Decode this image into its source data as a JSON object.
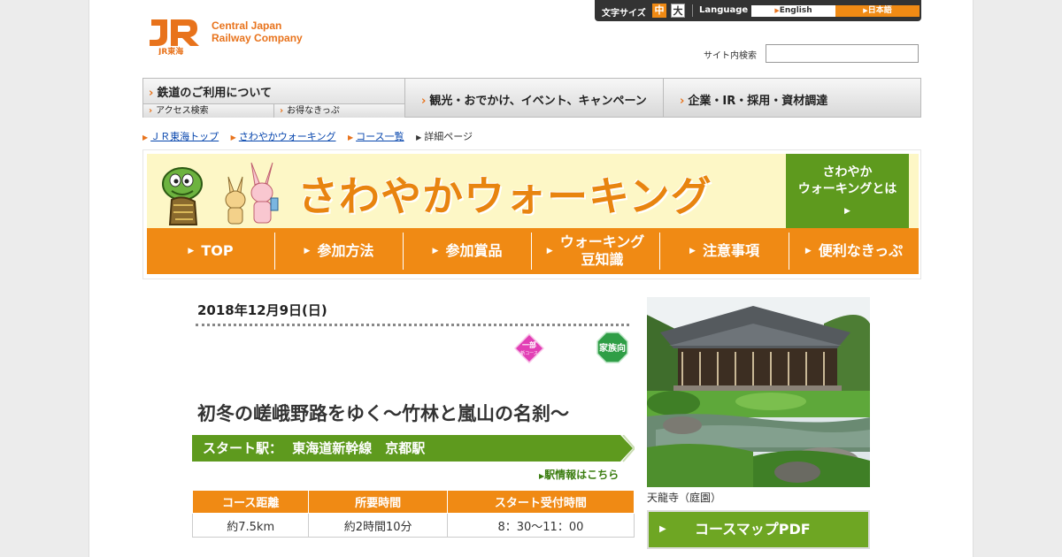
{
  "header": {
    "logo_text": "Central Japan\nRailway Company",
    "logo_subtext": "JR東海",
    "font_size_label": "文字サイズ",
    "font_size_medium": "中",
    "font_size_large": "大",
    "language_label": "Language",
    "lang_english": "English",
    "lang_japanese": "日本語",
    "search_label": "サイト内検索",
    "search_value": ""
  },
  "global_nav": {
    "railway": "鉄道のご利用について",
    "access_search": "アクセス検索",
    "tickets": "お得なきっぷ",
    "sightseeing": "観光・おでかけ、イベント、キャンペーン",
    "corporate": "企業・IR・採用・資材調達"
  },
  "breadcrumb": [
    "ＪＲ東海トップ",
    "さわやかウォーキング",
    "コース一覧",
    "詳細ページ"
  ],
  "banner": {
    "title": "さわやかウォーキング",
    "what_is": "さわやか\nウォーキングとは",
    "nav": [
      "TOP",
      "参加方法",
      "参加賞品",
      "ウォーキング\n豆知識",
      "注意事項",
      "便利なきっぷ"
    ]
  },
  "course": {
    "date": "2018年12月9日(日)",
    "badge_partial": "一部",
    "badge_partial_sub": "新コース",
    "badge_family": "家族向",
    "title": "初冬の嵯峨野路をゆく～竹林と嵐山の名刹～",
    "start_label": "スタート駅：",
    "start_station": "東海道新幹線　京都駅",
    "station_link": "駅情報はこちら",
    "table_headers": [
      "コース距離",
      "所要時間",
      "スタート受付時間"
    ],
    "table_values": [
      "約7.5km",
      "約2時間10分",
      "8：30～11：00"
    ],
    "photo_caption": "天龍寺（庭園）",
    "pdf_button": "コースマップPDF"
  },
  "colors": {
    "accent_orange": "#f08a14",
    "accent_green": "#5e9a1e"
  }
}
